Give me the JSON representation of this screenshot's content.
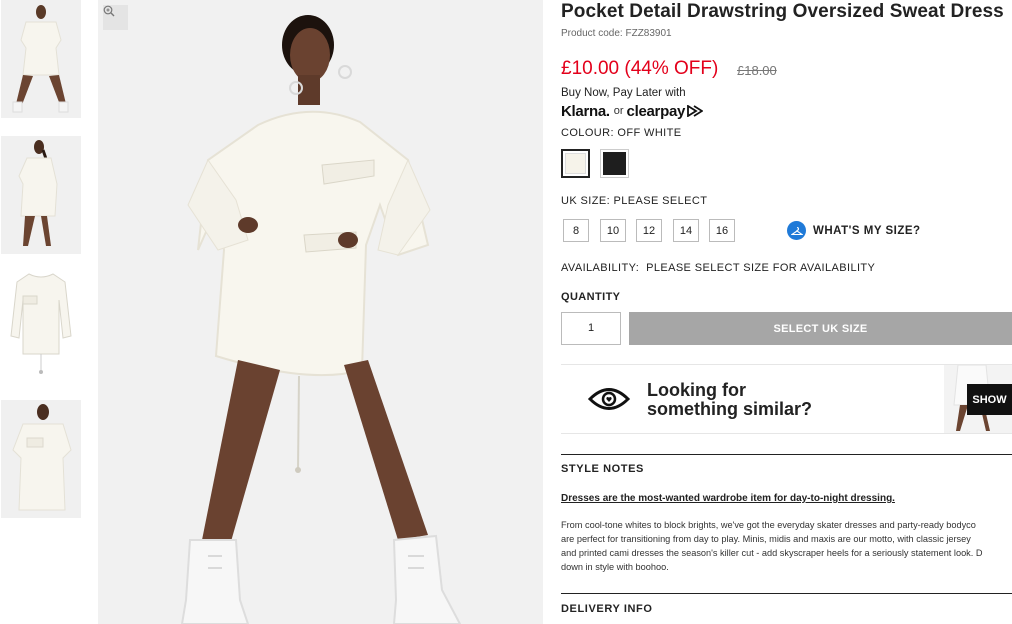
{
  "product": {
    "title": "Pocket Detail Drawstring Oversized Sweat Dress",
    "code": "Product code: FZZ83901",
    "price_now": "£10.00 (44% OFF)",
    "price_was": "£18.00"
  },
  "payment": {
    "bnpl_text": "Buy Now, Pay Later with",
    "klarna": "Klarna.",
    "or": "or",
    "clearpay": "clearpay"
  },
  "colour": {
    "label": "COLOUR:",
    "value": "OFF WHITE",
    "swatches": [
      {
        "name": "Off White",
        "color": "#f6f3ea"
      },
      {
        "name": "Black",
        "color": "#1e1e1e"
      }
    ]
  },
  "size": {
    "label": "UK SIZE:",
    "value": "PLEASE SELECT",
    "options": [
      "8",
      "10",
      "12",
      "14",
      "16"
    ],
    "guide_label": "WHAT'S MY SIZE?"
  },
  "availability": {
    "label": "AVAILABILITY:",
    "value": "PLEASE SELECT SIZE FOR AVAILABILITY"
  },
  "quantity": {
    "label": "QUANTITY",
    "value": "1"
  },
  "add_button": "SELECT UK SIZE",
  "similar": {
    "line1": "Looking for",
    "line2": "something similar?",
    "show_label": "SHOW"
  },
  "style_notes": {
    "title": "STYLE NOTES",
    "heading": "Dresses are the most-wanted wardrobe item for day-to-night dressing.",
    "lines": [
      "From cool-tone whites to block brights, we've got the everyday skater dresses and party-ready bodyco",
      "are perfect for transitioning from day to play. Minis, midis and maxis are our motto, with classic jersey",
      "and printed cami dresses the season's killer cut - add skyscraper heels for a seriously statement look. D",
      "down in style with boohoo."
    ]
  },
  "delivery": {
    "title": "DELIVERY INFO"
  },
  "colors": {
    "sale": "#e3001b",
    "disabled_button": "#a6a6a6",
    "size_guide": "#1f7ad8"
  }
}
